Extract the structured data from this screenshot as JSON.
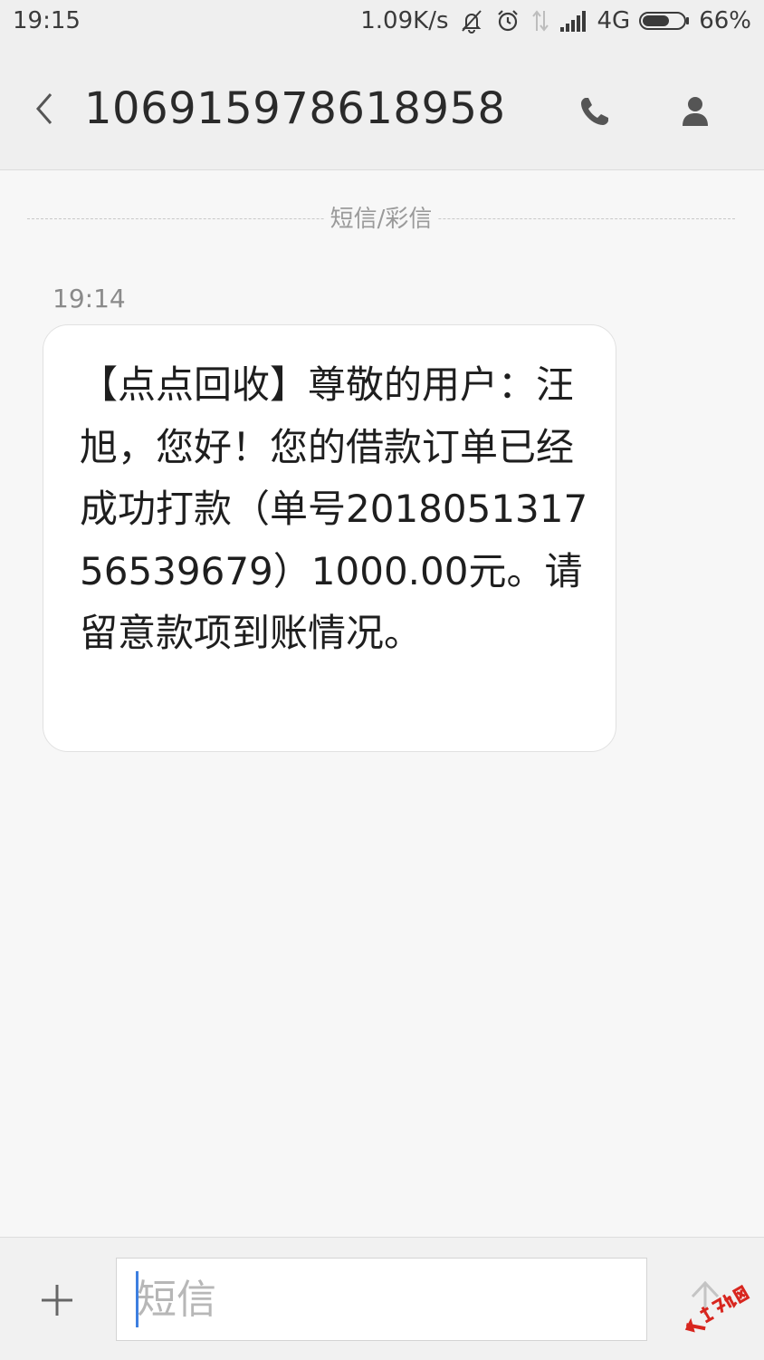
{
  "status_bar": {
    "time": "19:15",
    "network_speed": "1.09K/s",
    "network_type": "4G",
    "battery_percent": "66%",
    "battery_level": 0.66,
    "icons": [
      "mute-vibrate-icon",
      "alarm-icon",
      "data-arrows-icon",
      "signal-icon",
      "battery-icon"
    ]
  },
  "header": {
    "contact_number": "106915978618958",
    "icons": [
      "back-chevron-icon",
      "phone-icon",
      "person-icon"
    ]
  },
  "thread": {
    "divider_label": "短信/彩信",
    "messages": [
      {
        "time": "19:14",
        "text": "【点点回收】尊敬的用户：汪旭，您好！您的借款订单已经成功打款（单号2018051317565396​79）1000.00元。请留意款项到账情况。"
      }
    ]
  },
  "input_bar": {
    "placeholder": "短信",
    "value": "",
    "icons": [
      "plus-icon",
      "send-arrow-icon"
    ]
  },
  "colors": {
    "background": "#f7f7f7",
    "header_background": "#efefef",
    "bubble_background": "#ffffff",
    "cursor": "#3d7fe0"
  }
}
